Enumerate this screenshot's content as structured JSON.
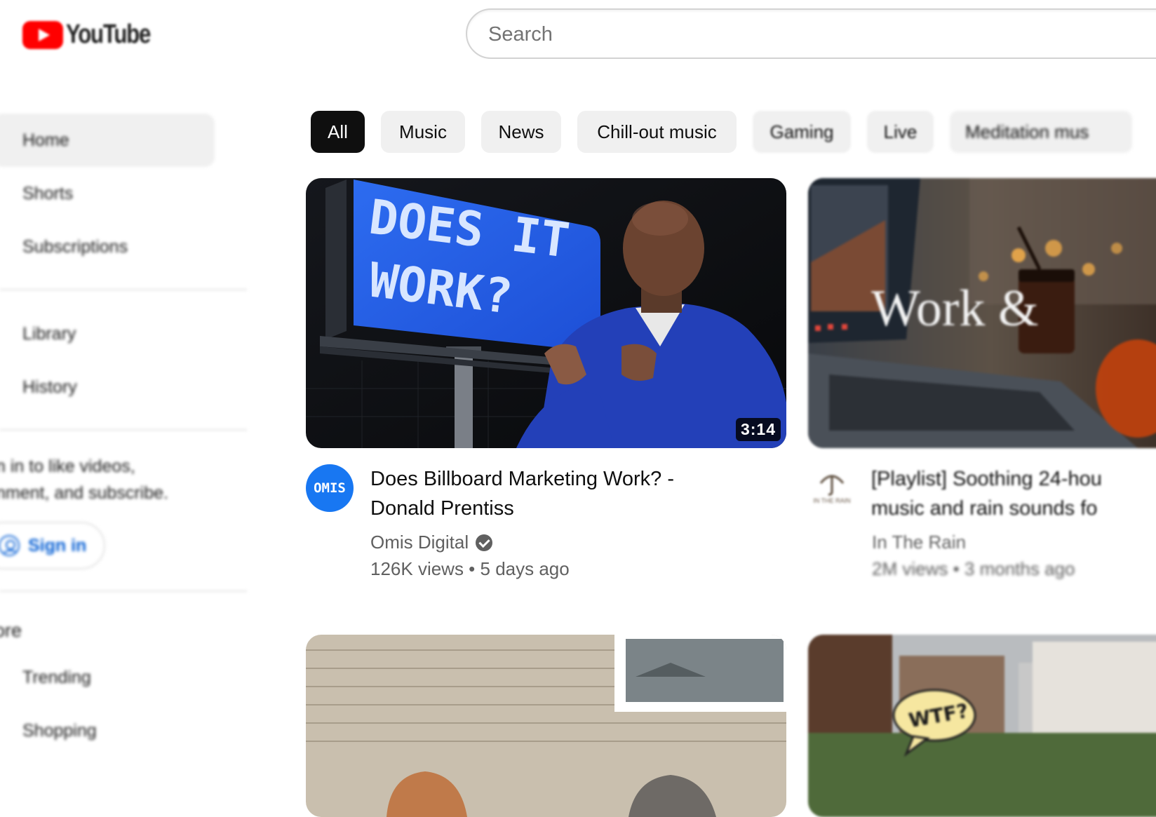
{
  "header": {
    "logo_text": "YouTube",
    "search_placeholder": "Search"
  },
  "sidebar": {
    "items": [
      {
        "label": "Home"
      },
      {
        "label": "Shorts"
      },
      {
        "label": "Subscriptions"
      },
      {
        "label": "Library"
      },
      {
        "label": "History"
      }
    ],
    "signin_prompt_line1": "n in to like videos,",
    "signin_prompt_line2": "nment, and subscribe.",
    "signin_button": "Sign in",
    "explore_title": "ore",
    "explore_items": [
      {
        "label": "Trending"
      },
      {
        "label": "Shopping"
      }
    ]
  },
  "chips": [
    "All",
    "Music",
    "News",
    "Chill-out music",
    "Gaming",
    "Live",
    "Meditation mus"
  ],
  "videos": [
    {
      "thumb_text_line1": "DOES IT",
      "thumb_text_line2": "WORK?",
      "duration": "3:14",
      "avatar_text": "OMIS",
      "title_line1": "Does Billboard Marketing Work? -",
      "title_line2": "Donald Prentiss",
      "channel": "Omis Digital",
      "meta": "126K views • 5 days ago"
    },
    {
      "thumb_text": "Work &",
      "avatar_text": "IN THE RAIN",
      "title_line1": "[Playlist] Soothing 24-hou",
      "title_line2": "music and rain sounds fo",
      "channel": "In The Rain",
      "meta": "2M views • 3 months ago"
    },
    {
      "thumb_text": "WTF?"
    }
  ],
  "colors": {
    "brand_red": "#ff0000",
    "chip_active": "#0f0f0f",
    "chip_bg": "#f0f0f0",
    "link_blue": "#065fd4",
    "omis_blue": "#1877f2"
  }
}
